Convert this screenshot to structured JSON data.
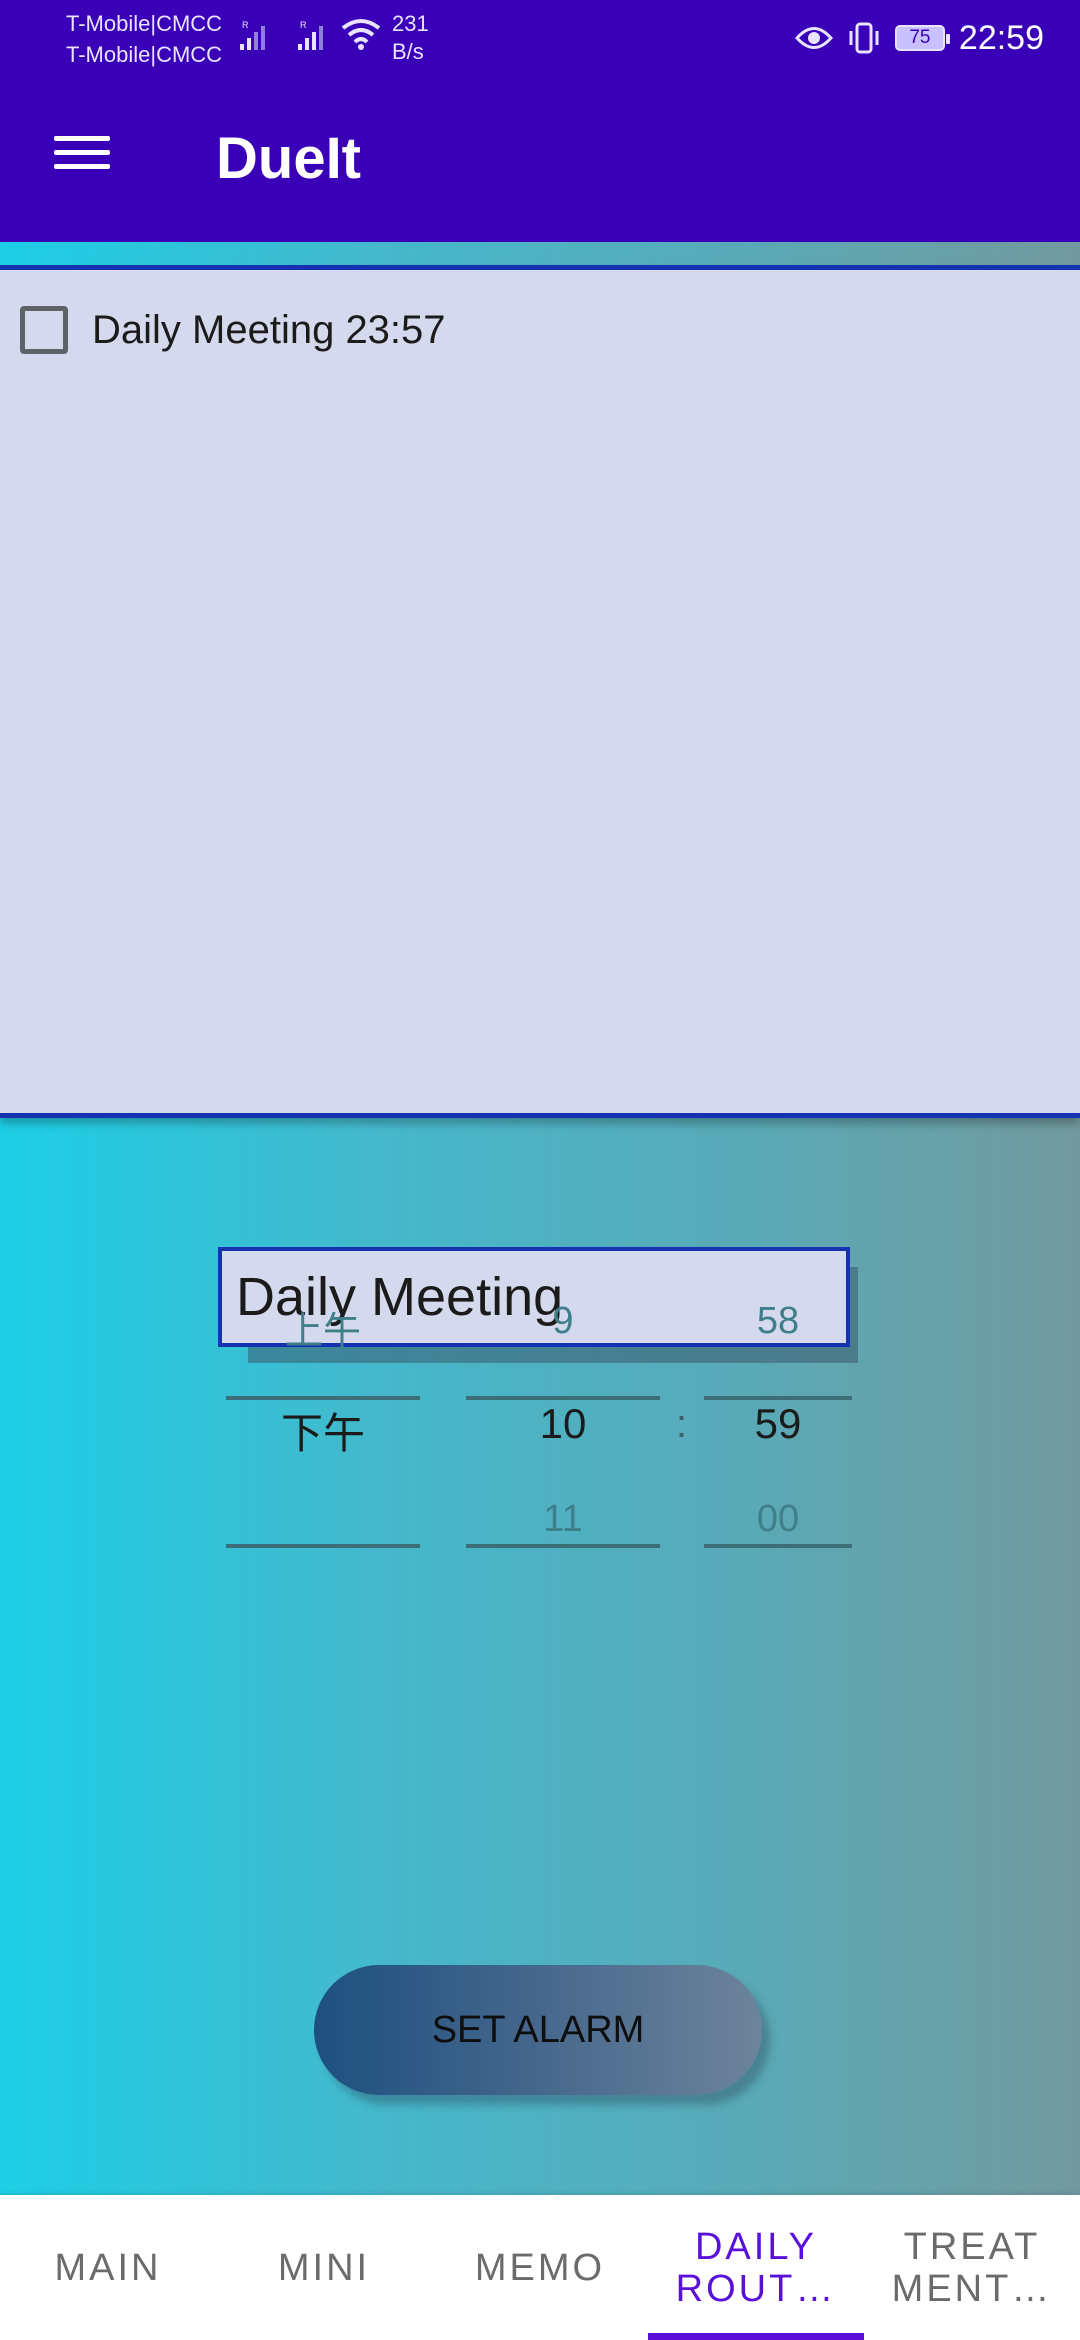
{
  "status_bar": {
    "carrier_1": "T-Mobile|CMCC",
    "carrier_2": "T-Mobile|CMCC",
    "net_speed_value": "231",
    "net_speed_unit": "B/s",
    "battery": "75",
    "time": "22:59",
    "icons": [
      "signal-icon",
      "signal-icon",
      "wifi-icon",
      "eye-icon",
      "vibrate-icon",
      "battery-icon"
    ]
  },
  "app_bar": {
    "title": "DueIt",
    "menu_icon": "hamburger-menu-icon"
  },
  "tasks": [
    {
      "label": "Daily Meeting 23:57",
      "checked": false
    }
  ],
  "form": {
    "name_value": "Daily Meeting",
    "set_alarm_label": "SET ALARM"
  },
  "time_picker": {
    "ampm": {
      "above": "上午",
      "selected": "下午",
      "below": ""
    },
    "hour": {
      "above": "9",
      "selected": "10",
      "below": "11"
    },
    "minute": {
      "above": "58",
      "selected": "59",
      "below": "00"
    },
    "separator": ":"
  },
  "tabs": [
    {
      "label": "MAIN",
      "active": false
    },
    {
      "label": "MINI",
      "active": false
    },
    {
      "label": "MEMO",
      "active": false
    },
    {
      "label": "DAILY ROUT…",
      "line1": "DAILY",
      "line2": "ROUT…",
      "active": true
    },
    {
      "label": "TREATMENT…",
      "line1": "TREAT",
      "line2": "MENT…",
      "active": false
    }
  ],
  "colors": {
    "primary": "#3a00b7",
    "accent": "#5a10d8",
    "panel": "#d5d9ed",
    "border": "#1533b0"
  }
}
